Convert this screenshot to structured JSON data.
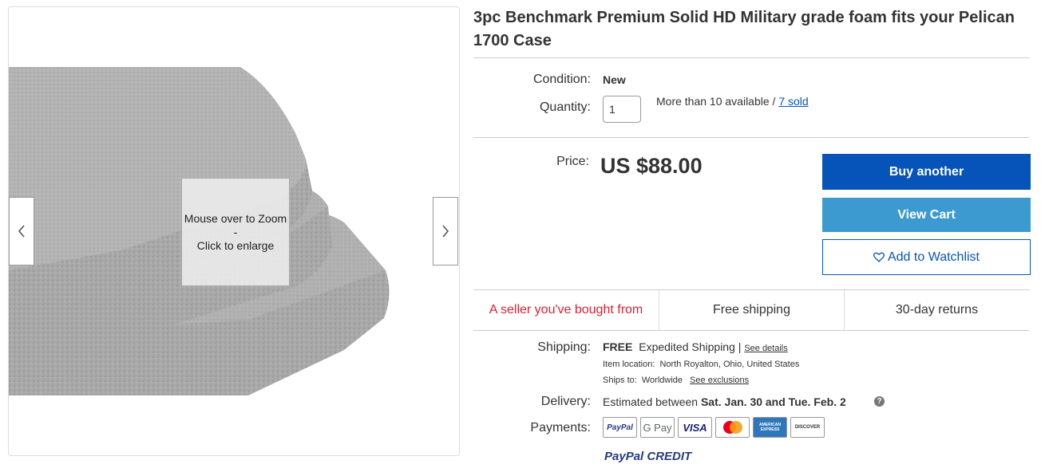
{
  "gallery": {
    "zoom_line1": "Mouse over to Zoom",
    "zoom_line2": "-",
    "zoom_line3": "Click to enlarge",
    "prev_icon": "chevron-left-icon",
    "next_icon": "chevron-right-icon"
  },
  "item": {
    "title": "3pc Benchmark Premium Solid HD Military grade foam fits your Pelican 1700 Case"
  },
  "condition": {
    "label": "Condition:",
    "value": "New"
  },
  "quantity": {
    "label": "Quantity:",
    "value": "1",
    "available_text": "More than 10 available /",
    "sold_link": "7 sold"
  },
  "price": {
    "label": "Price:",
    "value": "US $88.00"
  },
  "actions": {
    "buy": "Buy another",
    "cart": "View Cart",
    "watch": "Add to Watchlist",
    "watch_icon": "heart-icon"
  },
  "features": {
    "seller": "A seller you've bought from",
    "shipping": "Free shipping",
    "returns": "30-day returns"
  },
  "shipping": {
    "label": "Shipping:",
    "free": "FREE",
    "method": "Expedited Shipping |",
    "details_link": "See details",
    "location_label": "Item location:",
    "location": "North Royalton, Ohio, United States",
    "ships_label": "Ships to:",
    "ships_to": "Worldwide",
    "exclusions_link": "See exclusions"
  },
  "delivery": {
    "label": "Delivery:",
    "prefix": "Estimated between",
    "dates": "Sat. Jan. 30 and Tue. Feb. 2",
    "help_icon": "question-circle-icon"
  },
  "payments": {
    "label": "Payments:",
    "methods": [
      "PayPal",
      "G Pay",
      "VISA",
      "Mastercard",
      "AMERICAN EXPRESS",
      "DISCOVER"
    ],
    "credit_part1": "PayPal",
    "credit_part2": "CREDIT"
  },
  "colors": {
    "primary": "#0654ba",
    "secondary": "#3d9ad1",
    "seller_red": "#dd1e31"
  }
}
